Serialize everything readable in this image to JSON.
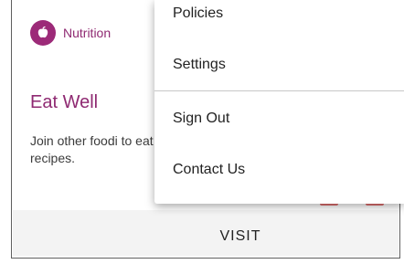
{
  "card": {
    "category": "Nutrition",
    "category_icon": "apple-icon",
    "title": "Eat Well",
    "description": "Join other foodi to eat healthy ar favorite recipes.",
    "visit_label": "VISIT",
    "colors": {
      "accent": "#9c2a78",
      "title": "#8f2a72"
    }
  },
  "menu": {
    "items": [
      {
        "label": "Policies"
      },
      {
        "label": "Settings"
      },
      {
        "label": "Sign Out"
      },
      {
        "label": "Contact Us"
      }
    ]
  }
}
